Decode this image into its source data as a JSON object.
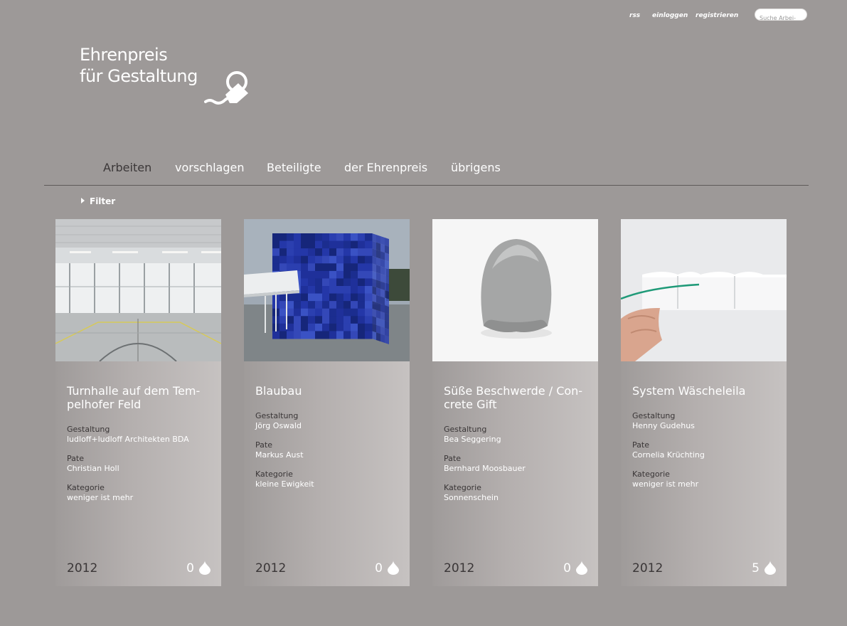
{
  "topbar": {
    "rss": "rss",
    "login": "einloggen",
    "register": "registrieren",
    "search_placeholder": "Suche Arbei-"
  },
  "logo": {
    "line1": "Ehrenpreis",
    "line2": "für Gestaltung"
  },
  "nav": [
    {
      "label": "Arbeiten",
      "active": true
    },
    {
      "label": "vorschlagen",
      "active": false
    },
    {
      "label": "Beteiligte",
      "active": false
    },
    {
      "label": "der Ehrenpreis",
      "active": false
    },
    {
      "label": "übrigens",
      "active": false
    }
  ],
  "filter": {
    "label": "Filter"
  },
  "cards": [
    {
      "title": "Turnhalle auf dem Tem-pelhofer Feld",
      "title_line1": "Turnhalle auf dem Tem-",
      "title_line2": "pelhofer Feld",
      "design_label": "Gestaltung",
      "design": "ludloff+ludloff Architekten BDA",
      "pate_label": "Pate",
      "pate": "Christian Holl",
      "category_label": "Kategorie",
      "category": "weniger ist mehr",
      "year": "2012",
      "count": "0",
      "image": "gym-hall-photo"
    },
    {
      "title": "Blaubau",
      "title_line1": "Blaubau",
      "title_line2": "",
      "design_label": "Gestaltung",
      "design": "Jörg Oswald",
      "pate_label": "Pate",
      "pate": "Markus Aust",
      "category_label": "Kategorie",
      "category": "kleine Ewigkeit",
      "year": "2012",
      "count": "0",
      "image": "blue-cube-building-photo"
    },
    {
      "title": "Süße Beschwerde / Concrete Gift",
      "title_line1": "Süße Beschwerde / Con-",
      "title_line2": "crete Gift",
      "design_label": "Gestaltung",
      "design": "Bea Seggering",
      "pate_label": "Pate",
      "pate": "Bernhard Moosbauer",
      "category_label": "Kategorie",
      "category": "Sonnenschein",
      "year": "2012",
      "count": "0",
      "image": "concrete-object-photo"
    },
    {
      "title": "System Wäscheleila",
      "title_line1": "System Wäscheleila",
      "title_line2": "",
      "design_label": "Gestaltung",
      "design": "Henny Gudehus",
      "pate_label": "Pate",
      "pate": "Cornelia Krüchting",
      "category_label": "Kategorie",
      "category": "weniger ist mehr",
      "year": "2012",
      "count": "5",
      "image": "wall-hook-photo"
    }
  ],
  "colors": {
    "background": "#9d9998",
    "text_dark": "#3a3637",
    "text_light": "#ffffff",
    "blue": "#2a3a9a"
  }
}
